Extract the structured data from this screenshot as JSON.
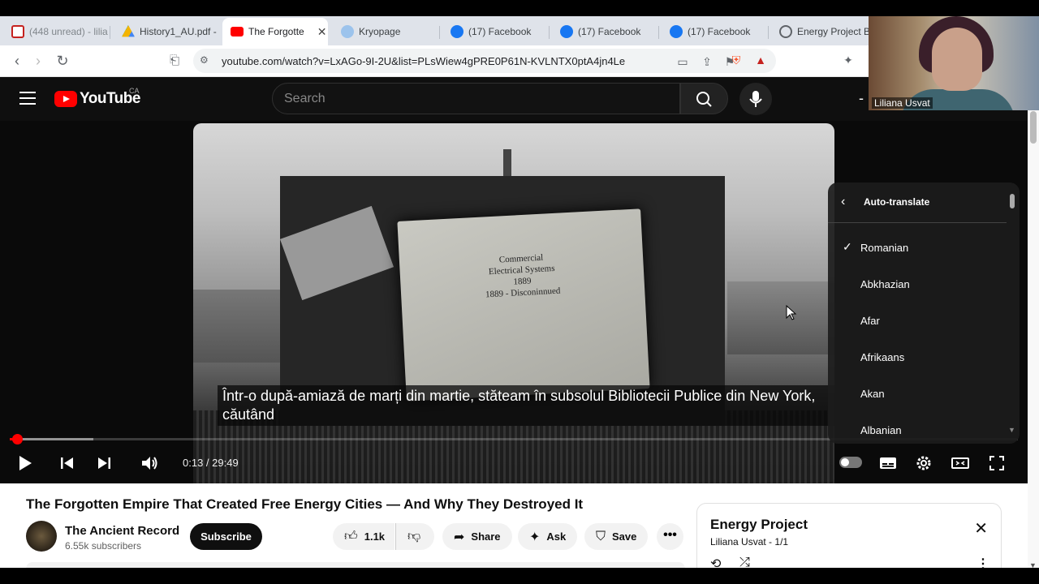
{
  "browser": {
    "tabs": [
      {
        "title": "(448 unread) - lilia",
        "fav_color": "#c5221f",
        "icon": "mail-icon"
      },
      {
        "title": "History1_AU.pdf -",
        "fav_color": "#1a73e8",
        "icon": "drive-icon"
      },
      {
        "title": "The Forgotte",
        "fav_color": "#ff0000",
        "icon": "youtube-icon",
        "active": true
      },
      {
        "title": "Kryopage",
        "fav_color": "#6aa8e8",
        "icon": "globe-icon"
      },
      {
        "title": "(17) Facebook",
        "fav_color": "#1877f2",
        "icon": "facebook-icon"
      },
      {
        "title": "(17) Facebook",
        "fav_color": "#1877f2",
        "icon": "facebook-icon"
      },
      {
        "title": "(17) Facebook",
        "fav_color": "#1877f2",
        "icon": "facebook-icon"
      },
      {
        "title": "Energy Project By",
        "fav_color": "#5f6368",
        "icon": "globe-icon"
      }
    ],
    "url": "youtube.com/watch?v=LxAGo-9I-2U&list=PLsWiew4gPRE0P61N-KVLNTX0ptA4jn4Le"
  },
  "youtube": {
    "logo_text": "YouTube",
    "country": "CA",
    "search_placeholder": "Search"
  },
  "video": {
    "book_lines": [
      "Commercial",
      "Electrical Systems",
      "1889",
      "1889 - Disconinnued"
    ],
    "subtitle": "Într-o după-amiază de marți din martie, stăteam în subsolul Bibliotecii Publice din New York, căutând",
    "time": "0:13 / 29:49",
    "played_fraction": 0.0073,
    "loaded_fraction": 0.083
  },
  "settings_menu": {
    "title": "Auto-translate",
    "items": [
      {
        "label": "Romanian",
        "checked": true
      },
      {
        "label": "Abkhazian",
        "checked": false
      },
      {
        "label": "Afar",
        "checked": false
      },
      {
        "label": "Afrikaans",
        "checked": false
      },
      {
        "label": "Akan",
        "checked": false
      },
      {
        "label": "Albanian",
        "checked": false
      }
    ]
  },
  "webcam": {
    "name": "Liliana Usvat"
  },
  "details": {
    "title": "The Forgotten Empire That Created Free Energy Cities — And Why They Destroyed It",
    "channel": "The Ancient Record",
    "subscribers": "6.55k subscribers",
    "subscribe_label": "Subscribe",
    "likes": "1.1k",
    "share_label": "Share",
    "ask_label": "Ask",
    "save_label": "Save"
  },
  "playlist": {
    "title": "Energy Project",
    "owner": "Liliana Usvat",
    "position": "1/1"
  }
}
